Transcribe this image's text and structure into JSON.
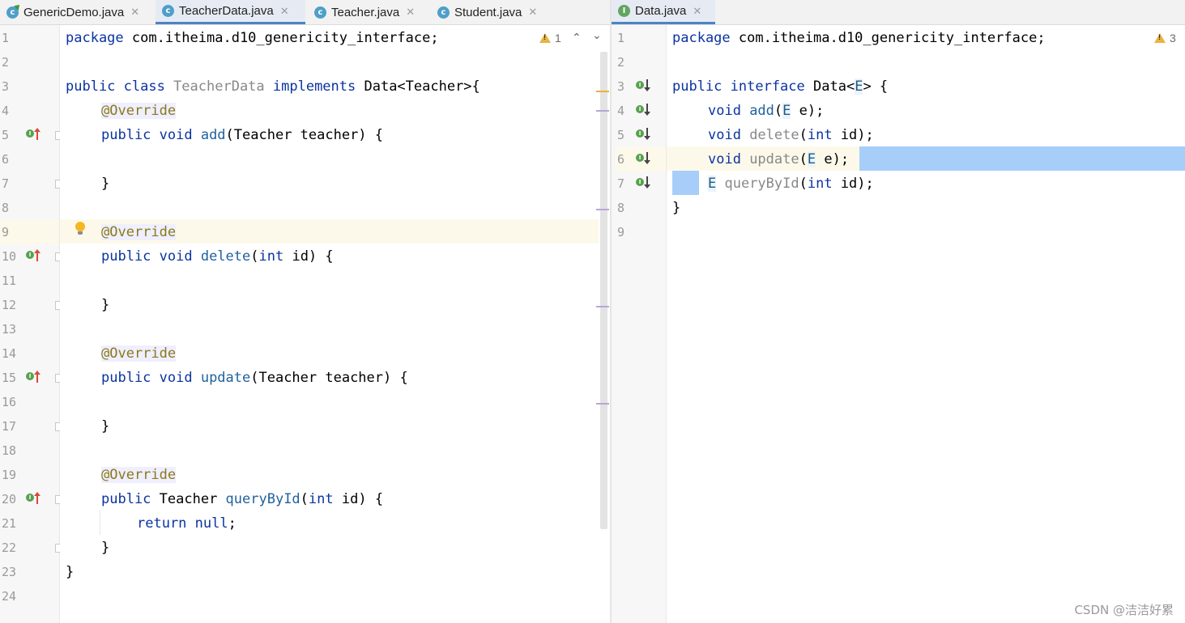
{
  "left": {
    "tabs": [
      {
        "label": "GenericDemo.java",
        "icon": "class-main-icon",
        "active": false
      },
      {
        "label": "TeacherData.java",
        "icon": "class-icon",
        "active": true
      },
      {
        "label": "Teacher.java",
        "icon": "class-icon",
        "active": false
      },
      {
        "label": "Student.java",
        "icon": "class-icon",
        "active": false
      }
    ],
    "warning_count": "1",
    "line_numbers": [
      "1",
      "2",
      "3",
      "4",
      "5",
      "6",
      "7",
      "8",
      "9",
      "10",
      "11",
      "12",
      "13",
      "14",
      "15",
      "16",
      "17",
      "18",
      "19",
      "20",
      "21",
      "22",
      "23",
      "24"
    ],
    "code": {
      "l1_kw": "package",
      "l1_rest": " com.itheima.d10_genericity_interface;",
      "l3_kw1": "public class",
      "l3_cls": " TeacherData ",
      "l3_kw2": "implements",
      "l3_rest": " Data<Teacher>{",
      "annotation": "@Override",
      "l5_kw": "public void ",
      "l5_m": "add",
      "l5_rest": "(Teacher teacher) {",
      "brace": "}",
      "l10_kw": "public void ",
      "l10_m": "delete",
      "l10_p1": "(",
      "l10_int": "int",
      "l10_rest": " id) {",
      "l15_kw": "public void ",
      "l15_m": "update",
      "l15_rest": "(Teacher teacher) {",
      "l20_kw": "public",
      "l20_t": " Teacher ",
      "l20_m": "queryById",
      "l20_p1": "(",
      "l20_int": "int",
      "l20_rest": " id) {",
      "l21_kw": "return null",
      "l21_rest": ";"
    }
  },
  "right": {
    "tabs": [
      {
        "label": "Data.java",
        "icon": "interface-icon",
        "active": true
      }
    ],
    "warning_count": "3",
    "line_numbers": [
      "1",
      "2",
      "3",
      "4",
      "5",
      "6",
      "7",
      "8",
      "9"
    ],
    "code": {
      "l1_kw": "package",
      "l1_rest": " com.itheima.d10_genericity_interface;",
      "l3_kw": "public interface",
      "l3_a": " Data<",
      "l3_E": "E",
      "l3_b": "> {",
      "void": "void ",
      "E": "E",
      "l4_m": "add",
      "l4_a": "(",
      "l4_b": " e);",
      "l5_m": "delete",
      "l5_a": "(",
      "l5_int": "int",
      "l5_b": " id);",
      "l6_m": "update",
      "l6_a": "(",
      "l6_b": " e);",
      "l7_m": " queryById",
      "l7_a": "(",
      "l7_int": "int",
      "l7_b": " id);",
      "l8": "}"
    }
  },
  "watermark": "CSDN @洁洁好累",
  "colors": {
    "keyword": "#0b34a1",
    "annotation": "#8a7a1a",
    "selection": "#a6cef8",
    "active_tab_border": "#4c83c4"
  }
}
